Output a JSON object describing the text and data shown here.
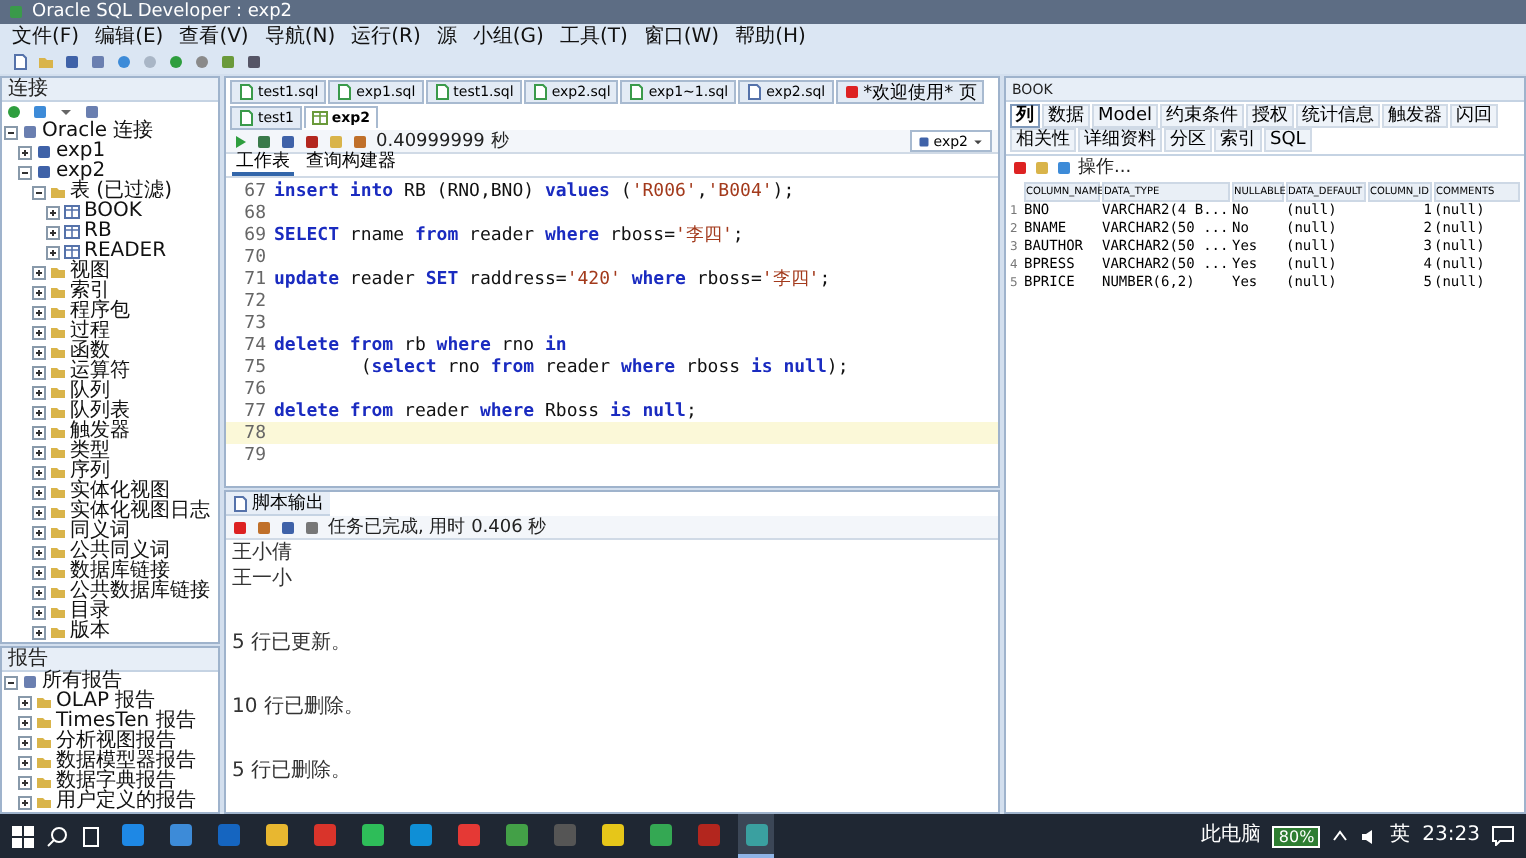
{
  "window": {
    "title": "Oracle SQL Developer : exp2"
  },
  "menu": [
    "文件(F)",
    "编辑(E)",
    "查看(V)",
    "导航(N)",
    "运行(R)",
    "源",
    "小组(G)",
    "工具(T)",
    "窗口(W)",
    "帮助(H)"
  ],
  "connections_panel": {
    "title": "连接",
    "tree": [
      {
        "label": "Oracle 连接",
        "kind": "root",
        "expanded": true,
        "children": [
          {
            "label": "exp1",
            "kind": "connection",
            "expanded": false
          },
          {
            "label": "exp2",
            "kind": "connection",
            "expanded": true,
            "children": [
              {
                "label": "表 (已过滤)",
                "kind": "folder",
                "expanded": true,
                "children": [
                  {
                    "label": "BOOK",
                    "kind": "table",
                    "expanded": false
                  },
                  {
                    "label": "RB",
                    "kind": "table",
                    "expanded": false
                  },
                  {
                    "label": "READER",
                    "kind": "table",
                    "expanded": false
                  }
                ]
              },
              {
                "label": "视图",
                "kind": "folder",
                "expanded": false
              },
              {
                "label": "索引",
                "kind": "folder",
                "expanded": false
              },
              {
                "label": "程序包",
                "kind": "folder",
                "expanded": false
              },
              {
                "label": "过程",
                "kind": "folder",
                "expanded": false
              },
              {
                "label": "函数",
                "kind": "folder",
                "expanded": false
              },
              {
                "label": "运算符",
                "kind": "folder",
                "expanded": false
              },
              {
                "label": "队列",
                "kind": "folder",
                "expanded": false
              },
              {
                "label": "队列表",
                "kind": "folder",
                "expanded": false
              },
              {
                "label": "触发器",
                "kind": "folder",
                "expanded": false
              },
              {
                "label": "类型",
                "kind": "folder",
                "expanded": false
              },
              {
                "label": "序列",
                "kind": "folder",
                "expanded": false
              },
              {
                "label": "实体化视图",
                "kind": "folder",
                "expanded": false
              },
              {
                "label": "实体化视图日志",
                "kind": "folder",
                "expanded": false
              },
              {
                "label": "同义词",
                "kind": "folder",
                "expanded": false
              },
              {
                "label": "公共同义词",
                "kind": "folder",
                "expanded": false
              },
              {
                "label": "数据库链接",
                "kind": "folder",
                "expanded": false
              },
              {
                "label": "公共数据库链接",
                "kind": "folder",
                "expanded": false
              },
              {
                "label": "目录",
                "kind": "folder",
                "expanded": false
              },
              {
                "label": "版本",
                "kind": "folder",
                "expanded": false
              }
            ]
          }
        ]
      }
    ]
  },
  "reports_panel": {
    "title": "报告",
    "tree": [
      {
        "label": "所有报告",
        "kind": "root",
        "expanded": true,
        "children": [
          {
            "label": "OLAP 报告",
            "kind": "folder",
            "expanded": false
          },
          {
            "label": "TimesTen 报告",
            "kind": "folder",
            "expanded": false
          },
          {
            "label": "分析视图报告",
            "kind": "folder",
            "expanded": false
          },
          {
            "label": "数据模型器报告",
            "kind": "folder",
            "expanded": false
          },
          {
            "label": "数据字典报告",
            "kind": "folder",
            "expanded": false
          },
          {
            "label": "用户定义的报告",
            "kind": "folder",
            "expanded": false
          }
        ]
      }
    ]
  },
  "doc_tabs": [
    {
      "label": "test1.sql",
      "kind": "sql",
      "selected": false
    },
    {
      "label": "exp1.sql",
      "kind": "sql",
      "selected": false
    },
    {
      "label": "test1.sql",
      "kind": "sql",
      "selected": false
    },
    {
      "label": "exp2.sql",
      "kind": "sql",
      "selected": false
    },
    {
      "label": "exp1~1.sql",
      "kind": "sql",
      "selected": false
    },
    {
      "label": "exp2.sql",
      "kind": "file",
      "selected": false
    },
    {
      "label": "*欢迎使用* 页",
      "kind": "web",
      "selected": false
    },
    {
      "label": "test1",
      "kind": "sql",
      "selected": false
    },
    {
      "label": "exp2",
      "kind": "db",
      "selected": true
    }
  ],
  "editor_toolbar": {
    "elapsed": "0.40999999 秒",
    "connection": "exp2"
  },
  "worksheet_tabs": [
    {
      "label": "工作表",
      "selected": true
    },
    {
      "label": "查询构建器",
      "selected": false
    }
  ],
  "editor": {
    "lines": [
      {
        "number": "67",
        "current": false,
        "tokens": [
          {
            "kind": "kw",
            "text": "insert into"
          },
          {
            "kind": "plain",
            "text": " RB (RNO,BNO) "
          },
          {
            "kind": "kw",
            "text": "values"
          },
          {
            "kind": "plain",
            "text": " ("
          },
          {
            "kind": "str",
            "text": "'R006'"
          },
          {
            "kind": "plain",
            "text": ","
          },
          {
            "kind": "str",
            "text": "'B004'"
          },
          {
            "kind": "plain",
            "text": ");"
          }
        ]
      },
      {
        "number": "68",
        "current": false
      },
      {
        "number": "69",
        "current": false,
        "tokens": [
          {
            "kind": "kw",
            "text": "SELECT"
          },
          {
            "kind": "plain",
            "text": " rname "
          },
          {
            "kind": "kw",
            "text": "from"
          },
          {
            "kind": "plain",
            "text": " reader "
          },
          {
            "kind": "kw",
            "text": "where"
          },
          {
            "kind": "plain",
            "text": " rboss="
          },
          {
            "kind": "str",
            "text": "'李四'"
          },
          {
            "kind": "plain",
            "text": ";"
          }
        ]
      },
      {
        "number": "70",
        "current": false
      },
      {
        "number": "71",
        "current": false,
        "tokens": [
          {
            "kind": "kw",
            "text": "update"
          },
          {
            "kind": "plain",
            "text": " reader "
          },
          {
            "kind": "kw",
            "text": "SET"
          },
          {
            "kind": "plain",
            "text": " raddress="
          },
          {
            "kind": "str",
            "text": "'420'"
          },
          {
            "kind": "kw",
            "text": " where"
          },
          {
            "kind": "plain",
            "text": " rboss="
          },
          {
            "kind": "str",
            "text": "'李四'"
          },
          {
            "kind": "plain",
            "text": ";"
          }
        ]
      },
      {
        "number": "72",
        "current": false
      },
      {
        "number": "73",
        "current": false
      },
      {
        "number": "74",
        "current": false,
        "tokens": [
          {
            "kind": "kw",
            "text": "delete from"
          },
          {
            "kind": "plain",
            "text": " rb "
          },
          {
            "kind": "kw",
            "text": "where"
          },
          {
            "kind": "plain",
            "text": " rno "
          },
          {
            "kind": "kw",
            "text": "in"
          }
        ]
      },
      {
        "number": "75",
        "current": false,
        "tokens": [
          {
            "kind": "plain",
            "text": "        ("
          },
          {
            "kind": "kw",
            "text": "select"
          },
          {
            "kind": "plain",
            "text": " rno "
          },
          {
            "kind": "kw",
            "text": "from"
          },
          {
            "kind": "plain",
            "text": " reader "
          },
          {
            "kind": "kw",
            "text": "where"
          },
          {
            "kind": "plain",
            "text": " rboss "
          },
          {
            "kind": "kw",
            "text": "is null"
          },
          {
            "kind": "plain",
            "text": ");"
          }
        ]
      },
      {
        "number": "76",
        "current": false
      },
      {
        "number": "77",
        "current": false,
        "tokens": [
          {
            "kind": "kw",
            "text": "delete from"
          },
          {
            "kind": "plain",
            "text": " reader "
          },
          {
            "kind": "kw",
            "text": "where"
          },
          {
            "kind": "plain",
            "text": " Rboss "
          },
          {
            "kind": "kw",
            "text": "is null"
          },
          {
            "kind": "plain",
            "text": ";"
          }
        ]
      },
      {
        "number": "78",
        "current": true
      },
      {
        "number": "79",
        "current": false
      }
    ]
  },
  "output": {
    "tab": "脚本输出",
    "status": "任务已完成, 用时 0.406 秒",
    "entries": [
      {
        "kind": "row",
        "text": "王小倩"
      },
      {
        "kind": "row",
        "text": "王一小"
      },
      {
        "kind": "message",
        "text": "5 行已更新。"
      },
      {
        "kind": "message",
        "text": "10 行已删除。"
      },
      {
        "kind": "message",
        "text": "5 行已删除。"
      }
    ]
  },
  "object_panel": {
    "title": "BOOK",
    "tabs": [
      {
        "label": "列",
        "selected": true
      },
      {
        "label": "数据",
        "selected": false
      },
      {
        "label": "Model",
        "selected": false
      },
      {
        "label": "约束条件",
        "selected": false
      },
      {
        "label": "授权",
        "selected": false
      },
      {
        "label": "统计信息",
        "selected": false
      },
      {
        "label": "触发器",
        "selected": false
      },
      {
        "label": "闪回",
        "selected": false
      },
      {
        "label": "相关性",
        "selected": false
      },
      {
        "label": "详细资料",
        "selected": false
      },
      {
        "label": "分区",
        "selected": false
      },
      {
        "label": "索引",
        "selected": false
      },
      {
        "label": "SQL",
        "selected": false
      }
    ],
    "action": "操作...",
    "table": {
      "columns": [
        "COLUMN_NAME",
        "DATA_TYPE",
        "NULLABLE",
        "DATA_DEFAULT",
        "COLUMN_ID",
        "COMMENTS"
      ],
      "rows": [
        {
          "number": "1",
          "cells": [
            "BNO",
            "VARCHAR2(4 B...",
            "No",
            "(null)",
            "1",
            "(null)"
          ]
        },
        {
          "number": "2",
          "cells": [
            "BNAME",
            "VARCHAR2(50 ...",
            "No",
            "(null)",
            "2",
            "(null)"
          ]
        },
        {
          "number": "3",
          "cells": [
            "BAUTHOR",
            "VARCHAR2(50 ...",
            "Yes",
            "(null)",
            "3",
            "(null)"
          ]
        },
        {
          "number": "4",
          "cells": [
            "BPRESS",
            "VARCHAR2(50 ...",
            "Yes",
            "(null)",
            "4",
            "(null)"
          ]
        },
        {
          "number": "5",
          "cells": [
            "BPRICE",
            "NUMBER(6,2)",
            "Yes",
            "(null)",
            "5",
            "(null)"
          ]
        }
      ]
    }
  },
  "taskbar": {
    "apps": [
      {
        "color": "#1e88e5",
        "selected": false
      },
      {
        "color": "#3d8bd8",
        "selected": false
      },
      {
        "color": "#1565c0",
        "selected": false
      },
      {
        "color": "#e8b730",
        "selected": false
      },
      {
        "color": "#d9342b",
        "selected": false
      },
      {
        "color": "#2ebd59",
        "selected": false
      },
      {
        "color": "#0f8fd6",
        "selected": false
      },
      {
        "color": "#e53935",
        "selected": false
      },
      {
        "color": "#43a047",
        "selected": false
      },
      {
        "color": "#555555",
        "selected": false
      },
      {
        "color": "#e6c619",
        "selected": false
      },
      {
        "color": "#34a853",
        "selected": false
      },
      {
        "color": "#b3261e",
        "selected": false
      },
      {
        "color": "#3aa0a0",
        "selected": true
      }
    ],
    "tray": {
      "label": "此电脑",
      "battery": "80%",
      "ime": "英",
      "time": "23:23"
    }
  }
}
